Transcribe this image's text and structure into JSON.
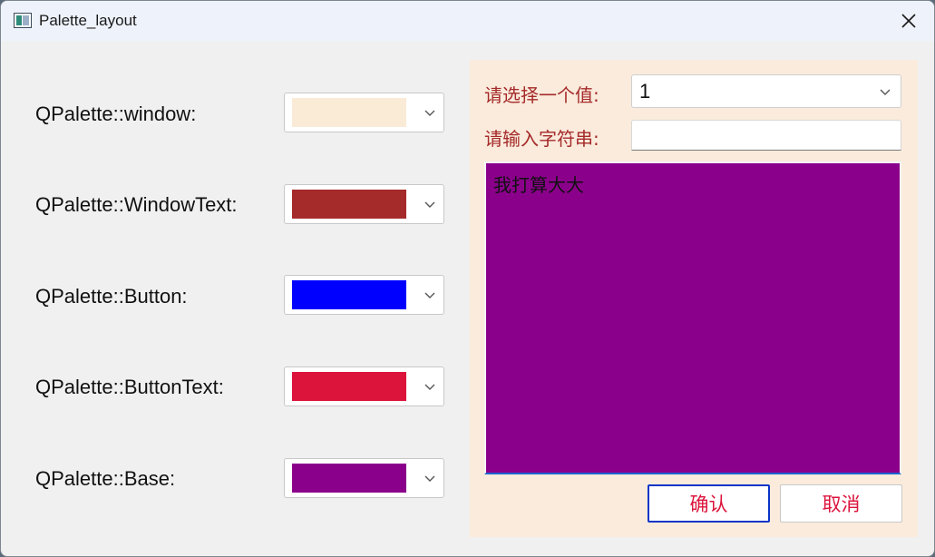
{
  "window": {
    "title": "Palette_layout"
  },
  "palette_rows": [
    {
      "label": "QPalette::window:",
      "color": "#faebd7"
    },
    {
      "label": "QPalette::WindowText:",
      "color": "#a52a2a"
    },
    {
      "label": "QPalette::Button:",
      "color": "#0000ff"
    },
    {
      "label": "QPalette::ButtonText:",
      "color": "#dc143c"
    },
    {
      "label": "QPalette::Base:",
      "color": "#8b008b"
    }
  ],
  "form": {
    "select_label": "请选择一个值:",
    "select_value": "1",
    "input_label": "请输入字符串:",
    "input_value": "",
    "text": "我打算大大"
  },
  "buttons": {
    "ok": "确认",
    "cancel": "取消"
  },
  "colors": {
    "panel_background": "#faebdc",
    "label_text": "#a52a2a",
    "button_text": "#dc143c",
    "text_area_background": "#8b008b"
  }
}
